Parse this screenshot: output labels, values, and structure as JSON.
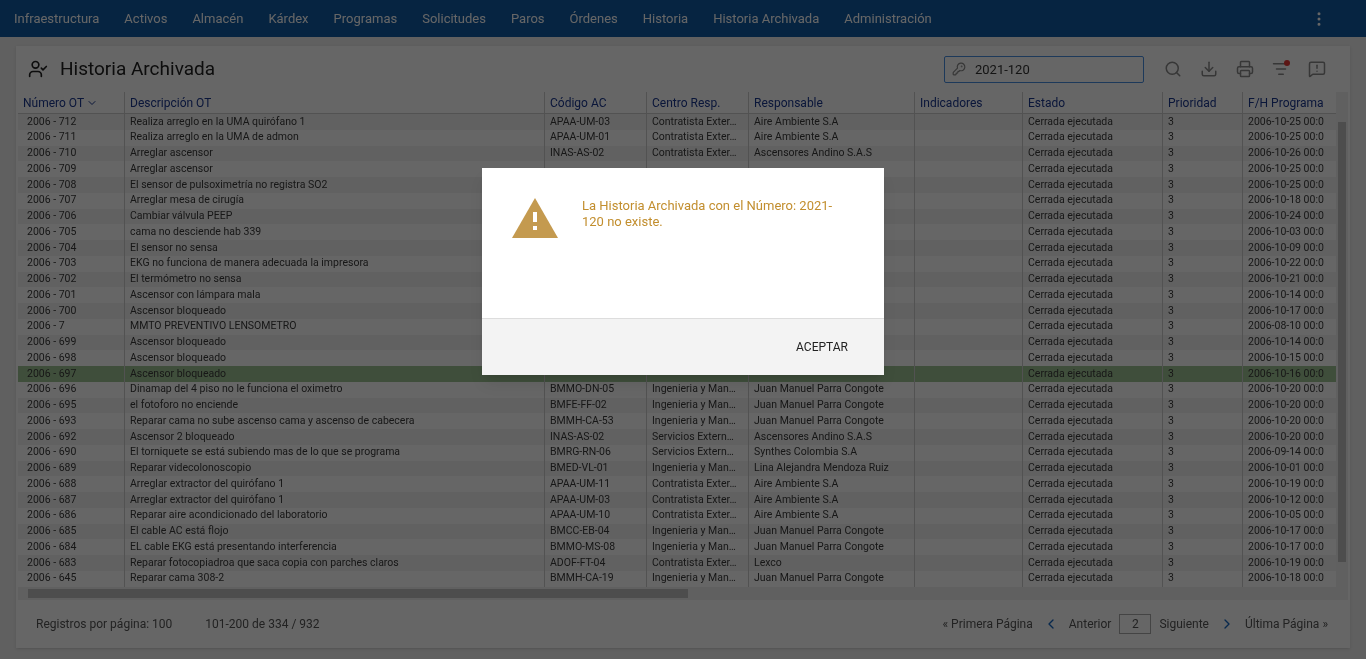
{
  "nav": {
    "items": [
      "Infraestructura",
      "Activos",
      "Almacén",
      "Kárdex",
      "Programas",
      "Solicitudes",
      "Paros",
      "Órdenes",
      "Historia",
      "Historia Archivada",
      "Administración"
    ]
  },
  "page": {
    "title": "Historia Archivada",
    "search": {
      "value": "2021-120"
    }
  },
  "table": {
    "columns": [
      {
        "label": "Número OT",
        "sorted": true
      },
      {
        "label": "Descripción OT",
        "sorted": false
      },
      {
        "label": "Código AC",
        "sorted": false
      },
      {
        "label": "Centro Resp.",
        "sorted": false
      },
      {
        "label": "Responsable",
        "sorted": false
      },
      {
        "label": "Indicadores",
        "sorted": false
      },
      {
        "label": "Estado",
        "sorted": false
      },
      {
        "label": "Prioridad",
        "sorted": false
      },
      {
        "label": "F/H Programa",
        "sorted": false
      }
    ],
    "rows": [
      {
        "numero": "2006 - 712",
        "descripcion": "Realiza arreglo en la UMA quirófano 1",
        "codigo": "APAA-UM-03",
        "centro": "Contratista Exter…",
        "responsable": "Aire Ambiente S.A",
        "estado": "Cerrada ejecutada",
        "prioridad": "3",
        "fecha": "2006-10-25 00:0",
        "selected": false
      },
      {
        "numero": "2006 - 711",
        "descripcion": "Realiza arreglo en la UMA de admon",
        "codigo": "APAA-UM-01",
        "centro": "Contratista Exter…",
        "responsable": "Aire Ambiente S.A",
        "estado": "Cerrada ejecutada",
        "prioridad": "3",
        "fecha": "2006-10-25 00:0",
        "selected": false
      },
      {
        "numero": "2006 - 710",
        "descripcion": "Arreglar ascensor",
        "codigo": "INAS-AS-02",
        "centro": "Contratista Exter…",
        "responsable": "Ascensores Andino S.A.S",
        "estado": "Cerrada ejecutada",
        "prioridad": "3",
        "fecha": "2006-10-26 00:0",
        "selected": false
      },
      {
        "numero": "2006 - 709",
        "descripcion": "Arreglar ascensor",
        "estado": "Cerrada ejecutada",
        "prioridad": "3",
        "fecha": "2006-10-25 00:0",
        "selected": false
      },
      {
        "numero": "2006 - 708",
        "descripcion": "El sensor de pulsoximetría no registra SO2",
        "estado": "Cerrada ejecutada",
        "prioridad": "3",
        "fecha": "2006-10-25 00:0",
        "selected": false
      },
      {
        "numero": "2006 - 707",
        "descripcion": "Arreglar mesa de cirugía",
        "estado": "Cerrada ejecutada",
        "prioridad": "3",
        "fecha": "2006-10-18 00:0",
        "selected": false
      },
      {
        "numero": "2006 - 706",
        "descripcion": "Cambiar válvula PEEP",
        "estado": "Cerrada ejecutada",
        "prioridad": "3",
        "fecha": "2006-10-24 00:0",
        "selected": false
      },
      {
        "numero": "2006 - 705",
        "descripcion": "cama no desciende hab 339",
        "estado": "Cerrada ejecutada",
        "prioridad": "3",
        "fecha": "2006-10-03 00:0",
        "selected": false
      },
      {
        "numero": "2006 - 704",
        "descripcion": "El sensor no sensa",
        "estado": "Cerrada ejecutada",
        "prioridad": "3",
        "fecha": "2006-10-09 00:0",
        "selected": false
      },
      {
        "numero": "2006 - 703",
        "descripcion": "EKG no funciona de manera adecuada la impresora",
        "estado": "Cerrada ejecutada",
        "prioridad": "3",
        "fecha": "2006-10-22 00:0",
        "selected": false
      },
      {
        "numero": "2006 - 702",
        "descripcion": "El termómetro no sensa",
        "estado": "Cerrada ejecutada",
        "prioridad": "3",
        "fecha": "2006-10-21 00:0",
        "selected": false
      },
      {
        "numero": "2006 - 701",
        "descripcion": "Ascensor con lámpara mala",
        "estado": "Cerrada ejecutada",
        "prioridad": "3",
        "fecha": "2006-10-14 00:0",
        "selected": false
      },
      {
        "numero": "2006 - 700",
        "descripcion": "Ascensor bloqueado",
        "estado": "Cerrada ejecutada",
        "prioridad": "3",
        "fecha": "2006-10-17 00:0",
        "selected": false
      },
      {
        "numero": "2006 - 7",
        "descripcion": "MMTO PREVENTIVO LENSOMETRO",
        "estado": "Cerrada ejecutada",
        "prioridad": "3",
        "fecha": "2006-08-10 00:0",
        "selected": false
      },
      {
        "numero": "2006 - 699",
        "descripcion": "Ascensor bloqueado",
        "estado": "Cerrada ejecutada",
        "prioridad": "3",
        "fecha": "2006-10-14 00:0",
        "selected": false
      },
      {
        "numero": "2006 - 698",
        "descripcion": "Ascensor bloqueado",
        "estado": "Cerrada ejecutada",
        "prioridad": "3",
        "fecha": "2006-10-15 00:0",
        "selected": false
      },
      {
        "numero": "2006 - 697",
        "descripcion": "Ascensor bloqueado",
        "estado": "Cerrada ejecutada",
        "prioridad": "3",
        "fecha": "2006-10-16 00:0",
        "selected": true
      },
      {
        "numero": "2006 - 696",
        "descripcion": "Dinamap del 4 piso no le funciona el oximetro",
        "codigo": "BMMO-DN-05",
        "centro": "Ingenieria y Man…",
        "responsable": "Juan Manuel Parra Congote",
        "estado": "Cerrada ejecutada",
        "prioridad": "3",
        "fecha": "2006-10-20 00:0",
        "selected": false
      },
      {
        "numero": "2006 - 695",
        "descripcion": "el fotoforo no enciende",
        "codigo": "BMFE-FF-02",
        "centro": "Ingenieria y Man…",
        "responsable": "Juan Manuel Parra Congote",
        "estado": "Cerrada ejecutada",
        "prioridad": "3",
        "fecha": "2006-10-20 00:0",
        "selected": false
      },
      {
        "numero": "2006 - 693",
        "descripcion": "Reparar cama no sube ascenso cama y ascenso de cabecera",
        "codigo": "BMMH-CA-53",
        "centro": "Ingenieria y Man…",
        "responsable": "Juan Manuel Parra Congote",
        "estado": "Cerrada ejecutada",
        "prioridad": "3",
        "fecha": "2006-10-20 00:0",
        "selected": false
      },
      {
        "numero": "2006 - 692",
        "descripcion": "Ascensor 2 bloqueado",
        "codigo": "INAS-AS-02",
        "centro": "Servicios Extern…",
        "responsable": "Ascensores Andino S.A.S",
        "estado": "Cerrada ejecutada",
        "prioridad": "3",
        "fecha": "2006-10-20 00:0",
        "selected": false
      },
      {
        "numero": "2006 - 690",
        "descripcion": "El torniquete se está subiendo mas de lo que se programa",
        "codigo": "BMRG-RN-06",
        "centro": "Servicios Extern…",
        "responsable": "Synthes Colombia S.A",
        "estado": "Cerrada ejecutada",
        "prioridad": "3",
        "fecha": "2006-09-14 00:0",
        "selected": false
      },
      {
        "numero": "2006 - 689",
        "descripcion": "Reparar videcolonoscopio",
        "codigo": "BMED-VL-01",
        "centro": "Ingenieria y Man…",
        "responsable": "Lina Alejandra Mendoza Ruiz",
        "estado": "Cerrada ejecutada",
        "prioridad": "3",
        "fecha": "2006-10-01 00:0",
        "selected": false
      },
      {
        "numero": "2006 - 688",
        "descripcion": "Arreglar extractor del quirófano 1",
        "codigo": "APAA-UM-11",
        "centro": "Contratista Exter…",
        "responsable": "Aire Ambiente S.A",
        "estado": "Cerrada ejecutada",
        "prioridad": "3",
        "fecha": "2006-10-19 00:0",
        "selected": false
      },
      {
        "numero": "2006 - 687",
        "descripcion": "Arreglar extractor del quirófano 1",
        "codigo": "APAA-UM-03",
        "centro": "Contratista Exter…",
        "responsable": "Aire Ambiente S.A",
        "estado": "Cerrada ejecutada",
        "prioridad": "3",
        "fecha": "2006-10-12 00:0",
        "selected": false
      },
      {
        "numero": "2006 - 686",
        "descripcion": "Reparar aire acondicionado del laboratorio",
        "codigo": "APAA-UM-10",
        "centro": "Contratista Exter…",
        "responsable": "Aire Ambiente S.A",
        "estado": "Cerrada ejecutada",
        "prioridad": "3",
        "fecha": "2006-10-05 00:0",
        "selected": false
      },
      {
        "numero": "2006 - 685",
        "descripcion": "El cable AC está flojo",
        "codigo": "BMCC-EB-04",
        "centro": "Ingenieria y Man…",
        "responsable": "Juan Manuel Parra Congote",
        "estado": "Cerrada ejecutada",
        "prioridad": "3",
        "fecha": "2006-10-17 00:0",
        "selected": false
      },
      {
        "numero": "2006 - 684",
        "descripcion": "EL cable EKG está presentando interferencia",
        "codigo": "BMMO-MS-08",
        "centro": "Ingenieria y Man…",
        "responsable": "Juan Manuel Parra Congote",
        "estado": "Cerrada ejecutada",
        "prioridad": "3",
        "fecha": "2006-10-17 00:0",
        "selected": false
      },
      {
        "numero": "2006 - 683",
        "descripcion": "Reparar fotocopiadroa que saca copia con parches claros",
        "codigo": "ADOF-FT-04",
        "centro": "Contratista Exter…",
        "responsable": "Lexco",
        "estado": "Cerrada ejecutada",
        "prioridad": "3",
        "fecha": "2006-10-19 00:0",
        "selected": false
      },
      {
        "numero": "2006 - 645",
        "descripcion": "Reparar cama 308-2",
        "codigo": "BMMH-CA-19",
        "centro": "Ingenieria y Man…",
        "responsable": "Juan Manuel Parra Congote",
        "estado": "Cerrada ejecutada",
        "prioridad": "3",
        "fecha": "2006-10-18 00:0",
        "selected": false
      }
    ]
  },
  "footer": {
    "per_page": "Registros por página: 100",
    "range": "101-200 de 334 / 932",
    "first": "« Primera Página",
    "prev": "Anterior",
    "page": "2",
    "next": "Siguiente",
    "last": "Última Página »"
  },
  "dialog": {
    "message": "La Historia Archivada con el Número: 2021-120 no existe.",
    "button": "ACEPTAR"
  }
}
